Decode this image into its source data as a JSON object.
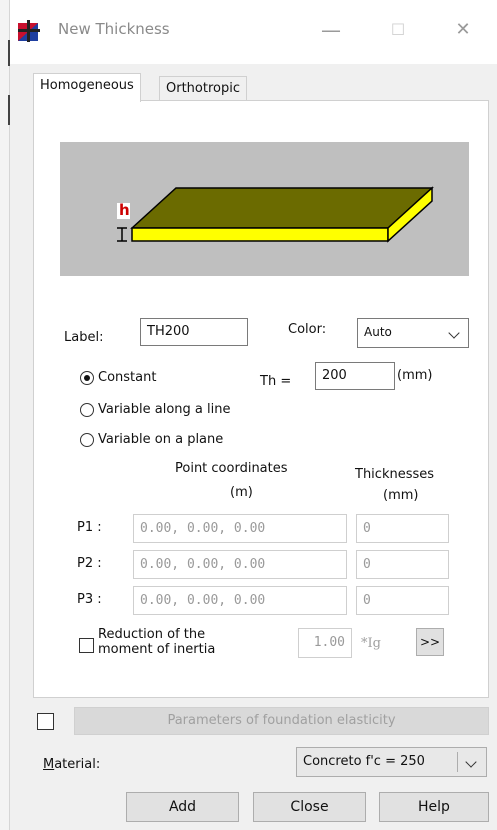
{
  "window": {
    "title": "New Thickness",
    "minimize_glyph": "—",
    "maximize_glyph": "☐",
    "close_glyph": "✕"
  },
  "tabs": [
    {
      "label": "Homogeneous",
      "active": true
    },
    {
      "label": "Orthotropic",
      "active": false
    }
  ],
  "preview": {
    "dimension_label": "h",
    "colors": {
      "slab_top": "#6b6b00",
      "slab_edge": "#ffff00",
      "background": "#bfbfbf",
      "dim_label": "#cc0000"
    }
  },
  "form": {
    "label_caption": "Label:",
    "label_value": "TH200",
    "color_caption": "Color:",
    "color_value": "Auto",
    "constant_label": "Constant",
    "th_caption": "Th =",
    "th_value": "200",
    "th_unit": "(mm)",
    "variable_line_label": "Variable along a line",
    "variable_plane_label": "Variable on a plane",
    "selected_mode": "Constant",
    "point_coords_header": "Point coordinates",
    "point_coords_unit": "(m)",
    "thicknesses_header": "Thicknesses",
    "thicknesses_unit": "(mm)",
    "points": [
      {
        "name": "P1 :",
        "coords": "0.00, 0.00, 0.00",
        "thickness": "0"
      },
      {
        "name": "P2 :",
        "coords": "0.00, 0.00, 0.00",
        "thickness": "0"
      },
      {
        "name": "P3 :",
        "coords": "0.00, 0.00, 0.00",
        "thickness": "0"
      }
    ],
    "reduction_line1": "Reduction of the",
    "reduction_line2": "moment of inertia",
    "reduction_value": "1.00",
    "reduction_unit": "*Ig",
    "reduction_more": ">>"
  },
  "foundation": {
    "button_label": "Parameters of foundation elasticity"
  },
  "material": {
    "caption": "Material:",
    "value": "Concreto f'c = 250"
  },
  "buttons": {
    "add": "Add",
    "close": "Close",
    "help": "Help"
  }
}
